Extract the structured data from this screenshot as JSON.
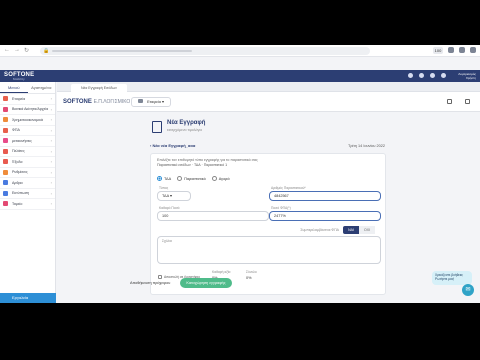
{
  "browser": {
    "percent": "100"
  },
  "app": {
    "logo": "SOFTONE",
    "logo_sub": "Mobility",
    "user": "Λογαριασμός Χρήστη"
  },
  "sidebar": {
    "tabs": [
      "Μενού",
      "Αγαπημένα"
    ],
    "items": [
      {
        "label": "Εταιρεία",
        "color": "#e8604c"
      },
      {
        "label": "Βασικά Ακίνητα/Αρχεία",
        "color": "#e34a73"
      },
      {
        "label": "Χρηματοοικονομικά",
        "color": "#ef8c3a"
      },
      {
        "label": "ΦΠΑ",
        "color": "#e8604c"
      },
      {
        "label": "μετακινήσεις",
        "color": "#e84c8a"
      },
      {
        "label": "Πελάτες",
        "color": "#e85a4f"
      },
      {
        "label": "Έξοδα",
        "color": "#e85a4f"
      },
      {
        "label": "Ρυθμίσεις",
        "color": "#ef8c3a"
      },
      {
        "label": "Αρθρα",
        "color": "#4a7be0"
      },
      {
        "label": "Εκτύπωση",
        "color": "#4a7be0"
      },
      {
        "label": "Ταμείο",
        "color": "#e34a73"
      }
    ],
    "footer": "Εργαλεία"
  },
  "tabstrip": {
    "tab": "Νέα Εγγραφή Εσόδων"
  },
  "subbar": {
    "brand": "SOFTONE",
    "brand_sub": "Ε.Π.ΛΟΓΙΣΜΙΚΟ",
    "company": "Εταιρεία"
  },
  "page": {
    "title": "Νέα Εγγραφή",
    "subtitle": "εισερχόμενο τιμολόγιο",
    "back": "Νέα νέα Εγγραφή_ααα",
    "date": "Τρίτη 14 Ιουνίου 2022",
    "intro1": "Επιλέξτε τον επιθυμητό τύπο εγγραφής για το παραστατικό σας",
    "intro2": "Παραστατικό εσόδων · ΤΔΑ · Παραστατικό 1",
    "radios": [
      "ΤΔΑ",
      "Παραστατικό",
      "Αγορά"
    ],
    "fields": {
      "type_label": "Τύπος",
      "type_value": "ΤΔΑ",
      "customer_label": "Αριθμός Παραστατικού*",
      "customer_value": "4842567",
      "amount_label": "Καθαρό Ποσό",
      "amount_value": "100",
      "vat_label": "Ποσό ΦΠΑ(*)",
      "vat_value": "2477%"
    },
    "toggle_label": "Συμπεριλαμβάνεται ΦΠΑ",
    "toggle": [
      "ΝΑΙ",
      "ΟΧΙ"
    ],
    "notes_label": "Σχόλια",
    "footer": {
      "check_label": "Αποστολή σε Λογιστήριο",
      "net_label": "Καθαρή αξία",
      "net_value": "0%",
      "total_label": "Σύνολο",
      "total_value": "0%",
      "draft": "Αποθήκευση πρόχειρου",
      "save": "Καταχώρηση εγγραφής"
    }
  },
  "chat": {
    "bubble": "Χρειάζεστε βοήθεια; Ρωτήστε μας!"
  }
}
